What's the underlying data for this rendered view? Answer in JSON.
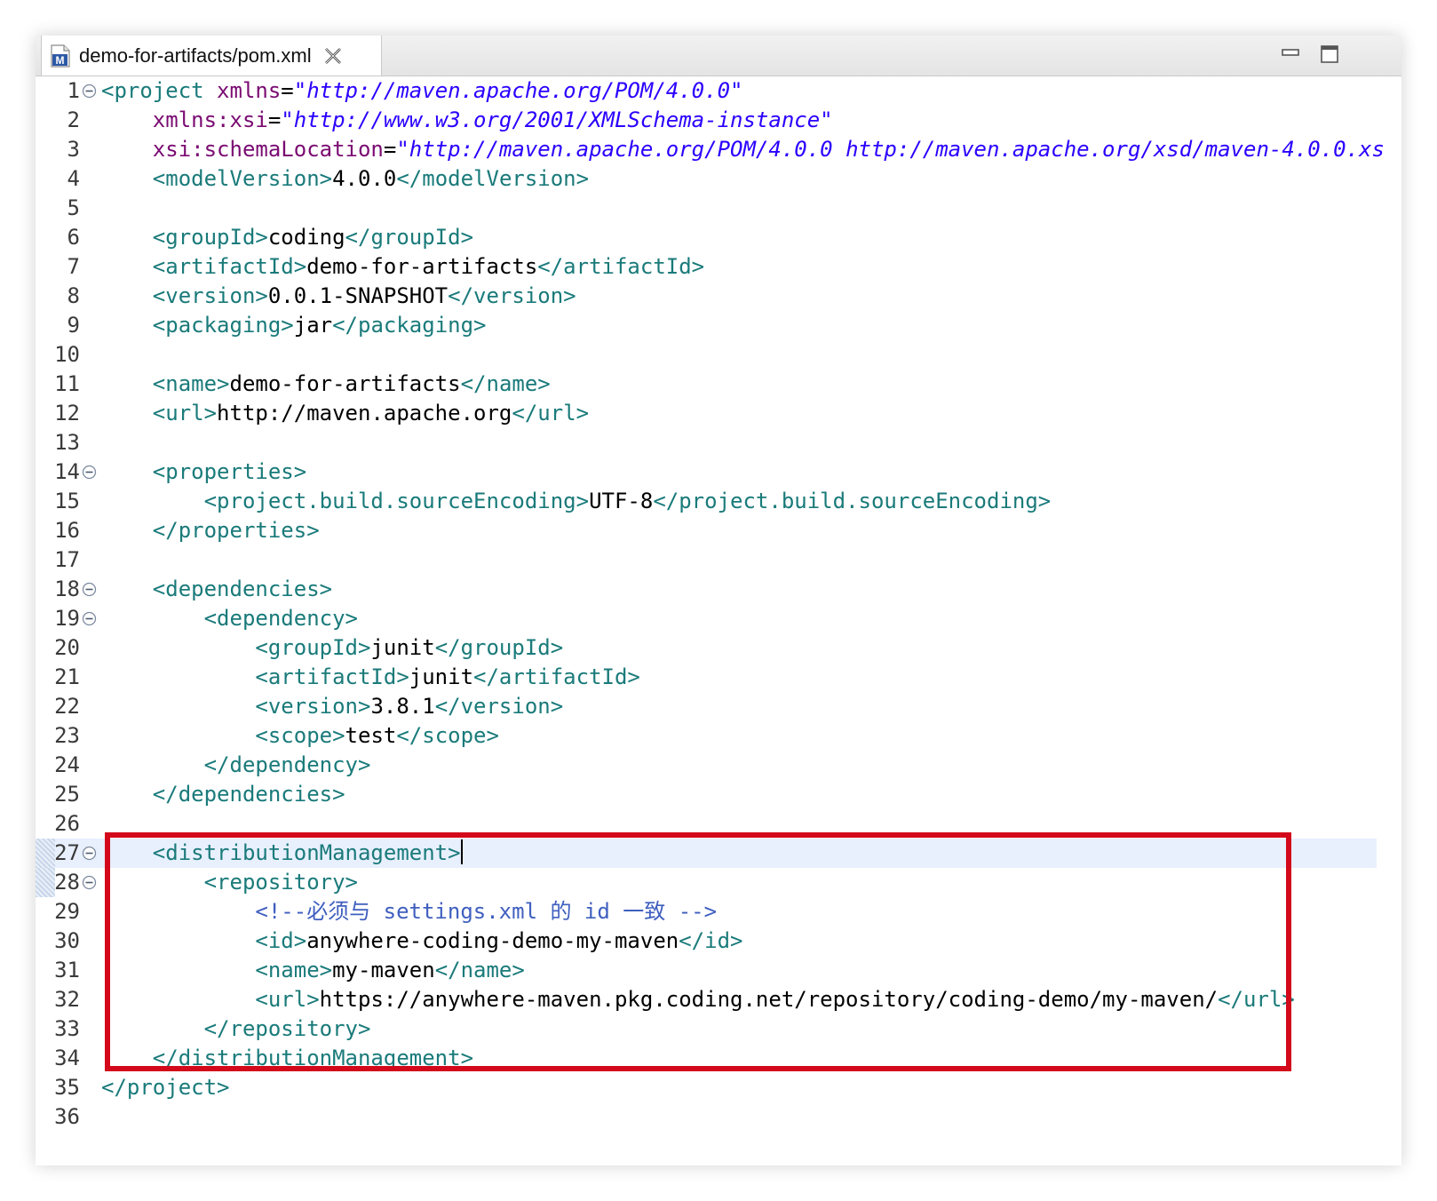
{
  "tab": {
    "title": "demo-for-artifacts/pom.xml",
    "icon": "maven-file-icon"
  },
  "window_controls": {
    "minimize": "minimize-icon",
    "maximize": "maximize-icon"
  },
  "colors": {
    "tag": "#1a7a7a",
    "attribute": "#7a0b72",
    "value": "#2a00ff",
    "comment": "#3f5fbf",
    "highlight_border": "#d3081b"
  },
  "editor": {
    "current_line": 27,
    "lines": [
      {
        "n": "1",
        "fold": true,
        "segs": [
          [
            "t",
            "<project "
          ],
          [
            "a",
            "xmlns"
          ],
          [
            "txt",
            "="
          ],
          [
            "v",
            "\"http://maven.apache.org/POM/4.0.0\""
          ]
        ]
      },
      {
        "n": "2",
        "fold": false,
        "segs": [
          [
            "txt",
            "    "
          ],
          [
            "a",
            "xmlns:xsi"
          ],
          [
            "txt",
            "="
          ],
          [
            "v",
            "\"http://www.w3.org/2001/XMLSchema-instance\""
          ]
        ]
      },
      {
        "n": "3",
        "fold": false,
        "segs": [
          [
            "txt",
            "    "
          ],
          [
            "a",
            "xsi:schemaLocation"
          ],
          [
            "txt",
            "="
          ],
          [
            "v",
            "\"http://maven.apache.org/POM/4.0.0 http://maven.apache.org/xsd/maven-4.0.0.xs"
          ]
        ]
      },
      {
        "n": "4",
        "fold": false,
        "segs": [
          [
            "txt",
            "    "
          ],
          [
            "t",
            "<modelVersion>"
          ],
          [
            "txt",
            "4.0.0"
          ],
          [
            "t",
            "</modelVersion>"
          ]
        ]
      },
      {
        "n": "5",
        "fold": false,
        "segs": []
      },
      {
        "n": "6",
        "fold": false,
        "segs": [
          [
            "txt",
            "    "
          ],
          [
            "t",
            "<groupId>"
          ],
          [
            "txt",
            "coding"
          ],
          [
            "t",
            "</groupId>"
          ]
        ]
      },
      {
        "n": "7",
        "fold": false,
        "segs": [
          [
            "txt",
            "    "
          ],
          [
            "t",
            "<artifactId>"
          ],
          [
            "txt",
            "demo-for-artifacts"
          ],
          [
            "t",
            "</artifactId>"
          ]
        ]
      },
      {
        "n": "8",
        "fold": false,
        "segs": [
          [
            "txt",
            "    "
          ],
          [
            "t",
            "<version>"
          ],
          [
            "txt",
            "0.0.1-SNAPSHOT"
          ],
          [
            "t",
            "</version>"
          ]
        ]
      },
      {
        "n": "9",
        "fold": false,
        "segs": [
          [
            "txt",
            "    "
          ],
          [
            "t",
            "<packaging>"
          ],
          [
            "txt",
            "jar"
          ],
          [
            "t",
            "</packaging>"
          ]
        ]
      },
      {
        "n": "10",
        "fold": false,
        "segs": []
      },
      {
        "n": "11",
        "fold": false,
        "segs": [
          [
            "txt",
            "    "
          ],
          [
            "t",
            "<name>"
          ],
          [
            "txt",
            "demo-for-artifacts"
          ],
          [
            "t",
            "</name>"
          ]
        ]
      },
      {
        "n": "12",
        "fold": false,
        "segs": [
          [
            "txt",
            "    "
          ],
          [
            "t",
            "<url>"
          ],
          [
            "txt",
            "http://maven.apache.org"
          ],
          [
            "t",
            "</url>"
          ]
        ]
      },
      {
        "n": "13",
        "fold": false,
        "segs": []
      },
      {
        "n": "14",
        "fold": true,
        "segs": [
          [
            "txt",
            "    "
          ],
          [
            "t",
            "<properties>"
          ]
        ]
      },
      {
        "n": "15",
        "fold": false,
        "segs": [
          [
            "txt",
            "        "
          ],
          [
            "t",
            "<project.build.sourceEncoding>"
          ],
          [
            "txt",
            "UTF-8"
          ],
          [
            "t",
            "</project.build.sourceEncoding>"
          ]
        ]
      },
      {
        "n": "16",
        "fold": false,
        "segs": [
          [
            "txt",
            "    "
          ],
          [
            "t",
            "</properties>"
          ]
        ]
      },
      {
        "n": "17",
        "fold": false,
        "segs": []
      },
      {
        "n": "18",
        "fold": true,
        "segs": [
          [
            "txt",
            "    "
          ],
          [
            "t",
            "<dependencies>"
          ]
        ]
      },
      {
        "n": "19",
        "fold": true,
        "segs": [
          [
            "txt",
            "        "
          ],
          [
            "t",
            "<dependency>"
          ]
        ]
      },
      {
        "n": "20",
        "fold": false,
        "segs": [
          [
            "txt",
            "            "
          ],
          [
            "t",
            "<groupId>"
          ],
          [
            "txt",
            "junit"
          ],
          [
            "t",
            "</groupId>"
          ]
        ]
      },
      {
        "n": "21",
        "fold": false,
        "segs": [
          [
            "txt",
            "            "
          ],
          [
            "t",
            "<artifactId>"
          ],
          [
            "txt",
            "junit"
          ],
          [
            "t",
            "</artifactId>"
          ]
        ]
      },
      {
        "n": "22",
        "fold": false,
        "segs": [
          [
            "txt",
            "            "
          ],
          [
            "t",
            "<version>"
          ],
          [
            "txt",
            "3.8.1"
          ],
          [
            "t",
            "</version>"
          ]
        ]
      },
      {
        "n": "23",
        "fold": false,
        "segs": [
          [
            "txt",
            "            "
          ],
          [
            "t",
            "<scope>"
          ],
          [
            "txt",
            "test"
          ],
          [
            "t",
            "</scope>"
          ]
        ]
      },
      {
        "n": "24",
        "fold": false,
        "segs": [
          [
            "txt",
            "        "
          ],
          [
            "t",
            "</dependency>"
          ]
        ]
      },
      {
        "n": "25",
        "fold": false,
        "segs": [
          [
            "txt",
            "    "
          ],
          [
            "t",
            "</dependencies>"
          ]
        ]
      },
      {
        "n": "26",
        "fold": false,
        "segs": []
      },
      {
        "n": "27",
        "fold": true,
        "segs": [
          [
            "txt",
            "    "
          ],
          [
            "t",
            "<distributionManagement>"
          ]
        ]
      },
      {
        "n": "28",
        "fold": true,
        "segs": [
          [
            "txt",
            "        "
          ],
          [
            "t",
            "<repository>"
          ]
        ]
      },
      {
        "n": "29",
        "fold": false,
        "segs": [
          [
            "txt",
            "            "
          ],
          [
            "c",
            "<!--必须与 settings.xml 的 id 一致 -->"
          ]
        ]
      },
      {
        "n": "30",
        "fold": false,
        "segs": [
          [
            "txt",
            "            "
          ],
          [
            "t",
            "<id>"
          ],
          [
            "txt",
            "anywhere-coding-demo-my-maven"
          ],
          [
            "t",
            "</id>"
          ]
        ]
      },
      {
        "n": "31",
        "fold": false,
        "segs": [
          [
            "txt",
            "            "
          ],
          [
            "t",
            "<name>"
          ],
          [
            "txt",
            "my-maven"
          ],
          [
            "t",
            "</name>"
          ]
        ]
      },
      {
        "n": "32",
        "fold": false,
        "segs": [
          [
            "txt",
            "            "
          ],
          [
            "t",
            "<url>"
          ],
          [
            "txt",
            "https://anywhere-maven.pkg.coding.net/repository/coding-demo/my-maven/"
          ],
          [
            "t",
            "</url>"
          ]
        ]
      },
      {
        "n": "33",
        "fold": false,
        "segs": [
          [
            "txt",
            "        "
          ],
          [
            "t",
            "</repository>"
          ]
        ]
      },
      {
        "n": "34",
        "fold": false,
        "segs": [
          [
            "txt",
            "    "
          ],
          [
            "t",
            "</distributionManagement>"
          ]
        ]
      },
      {
        "n": "35",
        "fold": false,
        "segs": [
          [
            "t",
            "</project>"
          ]
        ]
      },
      {
        "n": "36",
        "fold": false,
        "segs": []
      }
    ]
  }
}
